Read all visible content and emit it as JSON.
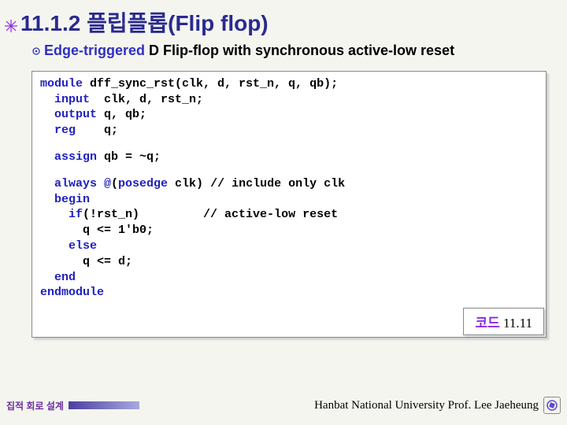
{
  "heading": "11.1.2 플립플롭(Flip flop)",
  "subhead": {
    "prefix": "Edge-triggered",
    "rest": " D Flip-flop with synchronous active-low reset"
  },
  "code": {
    "l1a": "module",
    "l1b": " dff_sync_rst(clk, d, rst_n, q, qb);",
    "l2a": "  input",
    "l2b": "  clk, d, rst_n;",
    "l3a": "  output",
    "l3b": " q, qb;",
    "l4a": "  reg",
    "l4b": "    q;",
    "l5a": "  assign",
    "l5b": " qb = ~q;",
    "l6a": "  always @",
    "l6b": "(",
    "l6c": "posedge",
    "l6d": " clk) ",
    "l6e": "// include only clk",
    "l7a": "  begin",
    "l8a": "    if",
    "l8b": "(!rst_n)         ",
    "l8c": "// active-low reset",
    "l9a": "      q <= 1'b0;",
    "l10a": "    else",
    "l11a": "      q <= d;",
    "l12a": "  end",
    "l13a": "endmodule"
  },
  "badge": {
    "label": "코드",
    "num": " 11.11"
  },
  "footer": {
    "left": "집적 회로 설계",
    "right": "Hanbat National University Prof. Lee Jaeheung"
  }
}
